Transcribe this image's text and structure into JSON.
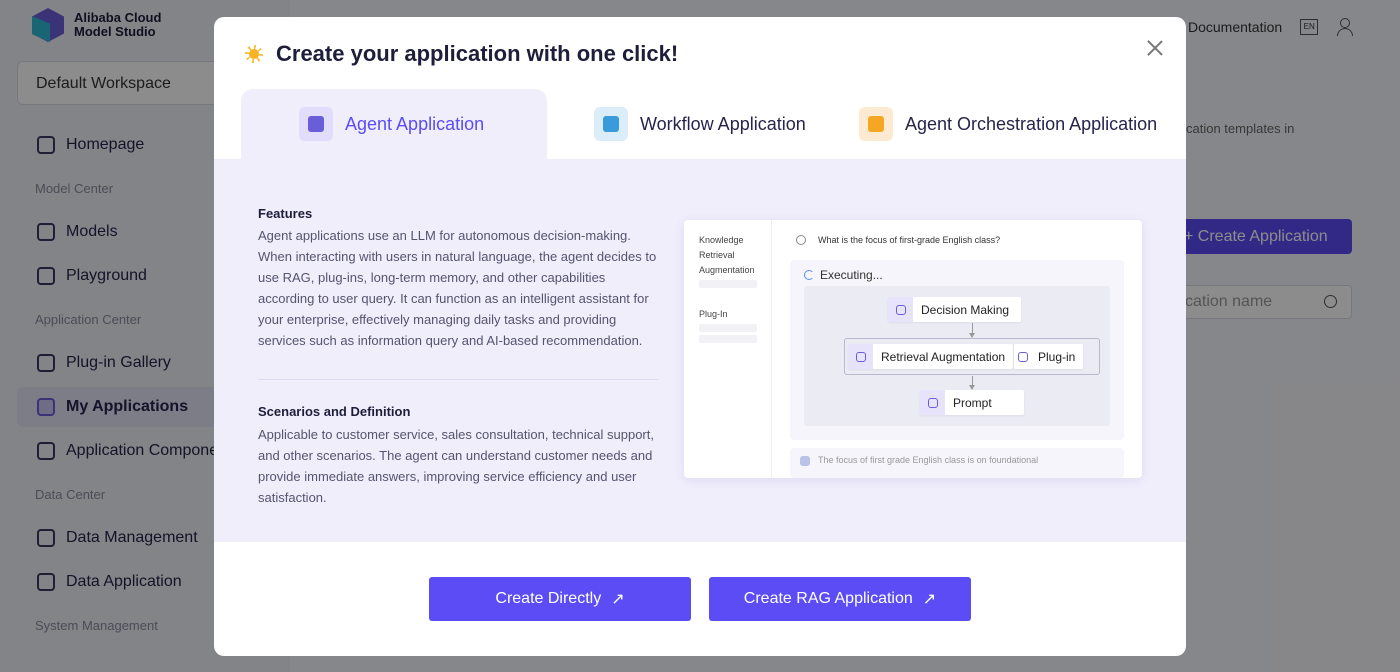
{
  "app": {
    "logo_line1": "Alibaba Cloud",
    "logo_line2": "Model Studio",
    "workspace": "Default Workspace"
  },
  "sidebar": {
    "homepage": "Homepage",
    "sections": [
      "Model Center",
      "Application Center",
      "Data Center",
      "System Management"
    ],
    "items": [
      {
        "label": "Models",
        "icon": "models-icon"
      },
      {
        "label": "Playground",
        "icon": "playground-icon"
      },
      {
        "label": "Plug-in Gallery",
        "icon": "plugin-icon"
      },
      {
        "label": "My Applications",
        "icon": "my-applications-icon",
        "active": true
      },
      {
        "label": "Application Components",
        "icon": "components-icon"
      },
      {
        "label": "Data Management",
        "icon": "database-icon"
      },
      {
        "label": "Data Application",
        "icon": "data-application-icon"
      }
    ]
  },
  "topbar": {
    "documentation": "Documentation",
    "language": "EN"
  },
  "background": {
    "description": "cation templates in",
    "create_button": "+ Create Application",
    "search_placeholder": "cation name"
  },
  "modal": {
    "title": "Create your application with one click!",
    "tabs": [
      {
        "label": "Agent Application",
        "active": true,
        "color": "#5b4cf5"
      },
      {
        "label": "Workflow Application",
        "color": "#3a9bdc"
      },
      {
        "label": "Agent Orchestration Application",
        "color": "#f5a623"
      }
    ],
    "features_heading": "Features",
    "features_text": "Agent applications use an LLM for autonomous decision-making. When interacting with users in natural language, the agent decides to use RAG, plug-ins, long-term memory, and other capabilities according to user query. It can function as an intelligent assistant for your enterprise, effectively managing daily tasks and providing services such as information query and AI-based recommendation.",
    "scenarios_heading": "Scenarios and Definition",
    "scenarios_text": "Applicable to customer service, sales consultation, technical support, and other scenarios. The agent can understand customer needs and provide immediate answers, improving service efficiency and user satisfaction.",
    "illustration": {
      "side_labels": [
        "Knowledge Retrieval Augmentation",
        "Plug-In"
      ],
      "question": "What is the focus of first-grade English class?",
      "status": "Executing...",
      "nodes": [
        "Decision Making",
        "Retrieval Augmentation",
        "Plug-in",
        "Prompt"
      ],
      "answer": "The focus of first grade English class is on foundational"
    },
    "buttons": {
      "create_directly": "Create Directly",
      "create_rag": "Create RAG Application"
    }
  }
}
